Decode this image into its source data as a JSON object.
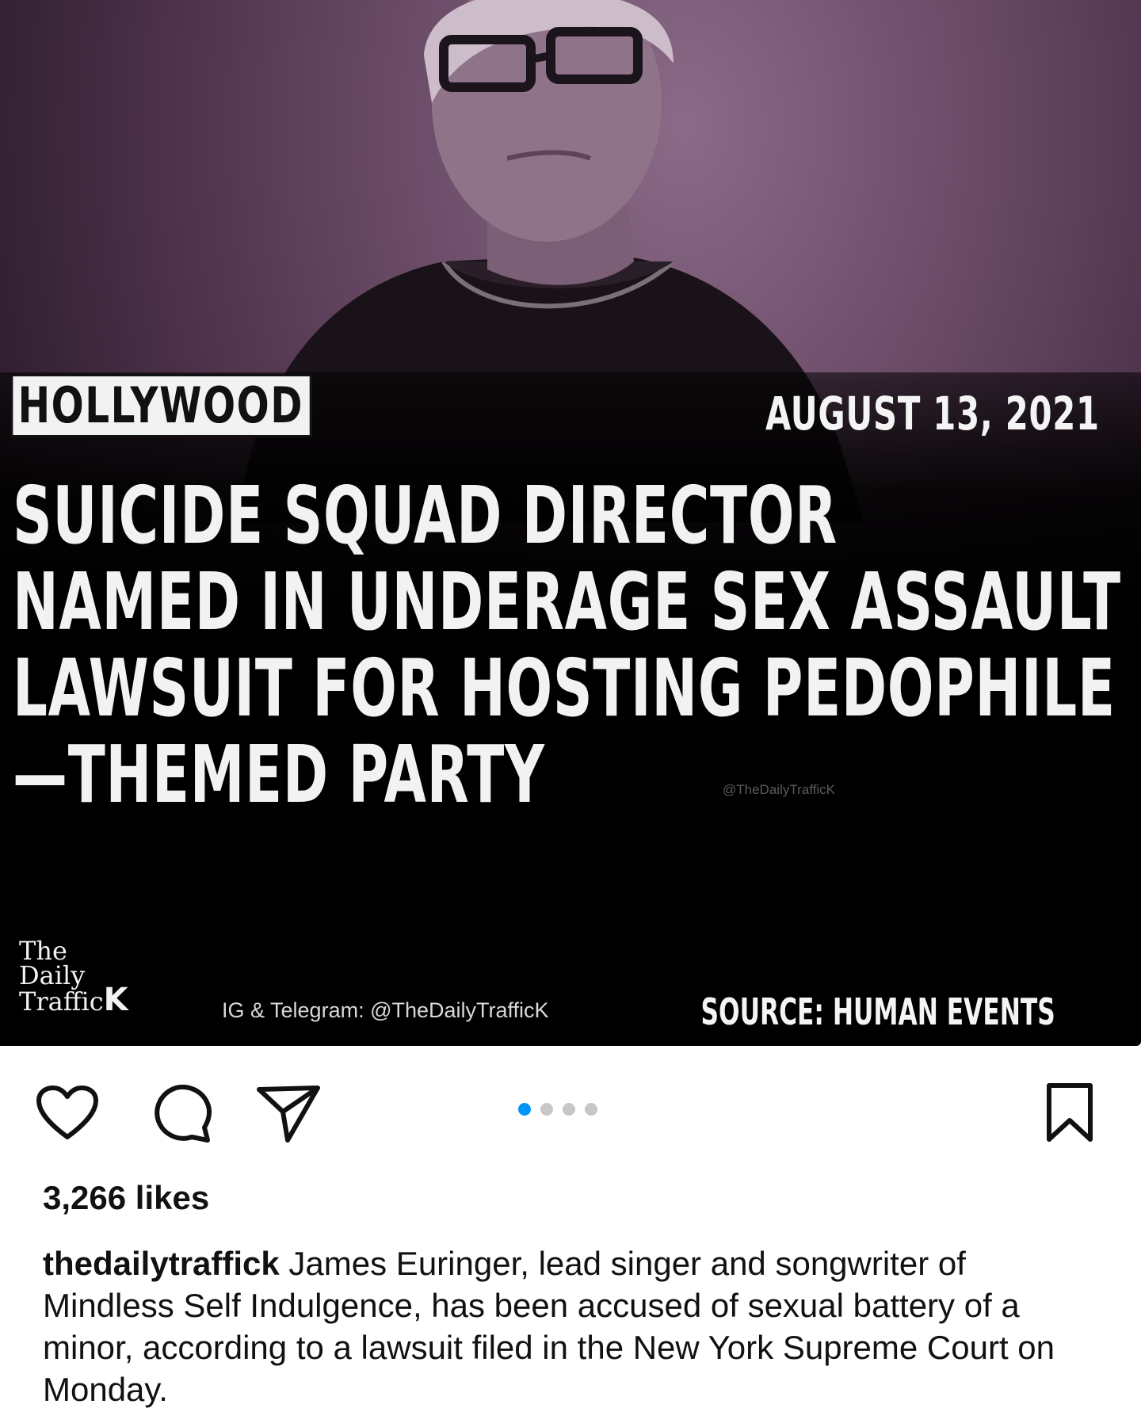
{
  "post": {
    "category": "HOLLYWOOD",
    "date": "AUGUST 13, 2021",
    "headline_lines": [
      "SUICIDE SQUAD DIRECTOR",
      "NAMED IN UNDERAGE SEX ASSAULT",
      "LAWSUIT FOR HOSTING PEDOPHILE",
      "—THEMED PARTY"
    ],
    "watermark": "@TheDailyTrafficK",
    "brand": {
      "line1": "The",
      "line2": "Daily",
      "line3": "Traffic",
      "k": "K"
    },
    "handle_credit": "IG & Telegram: @TheDailyTrafficK",
    "source": "SOURCE: HUMAN EVENTS"
  },
  "actions": {
    "like_icon": "heart-icon",
    "comment_icon": "comment-bubble-icon",
    "share_icon": "paper-plane-icon",
    "save_icon": "bookmark-icon"
  },
  "carousel": {
    "count": 4,
    "active_index": 0,
    "active_color": "#0095f6",
    "inactive_color": "#c7c7c7"
  },
  "likes": "3,266 likes",
  "caption": {
    "username": "thedailytraffick",
    "text": " James Euringer, lead singer and songwriter of Mindless Self Indulgence, has been accused of sexual battery of a minor, according to a lawsuit filed in the New York Supreme Court on Monday."
  }
}
